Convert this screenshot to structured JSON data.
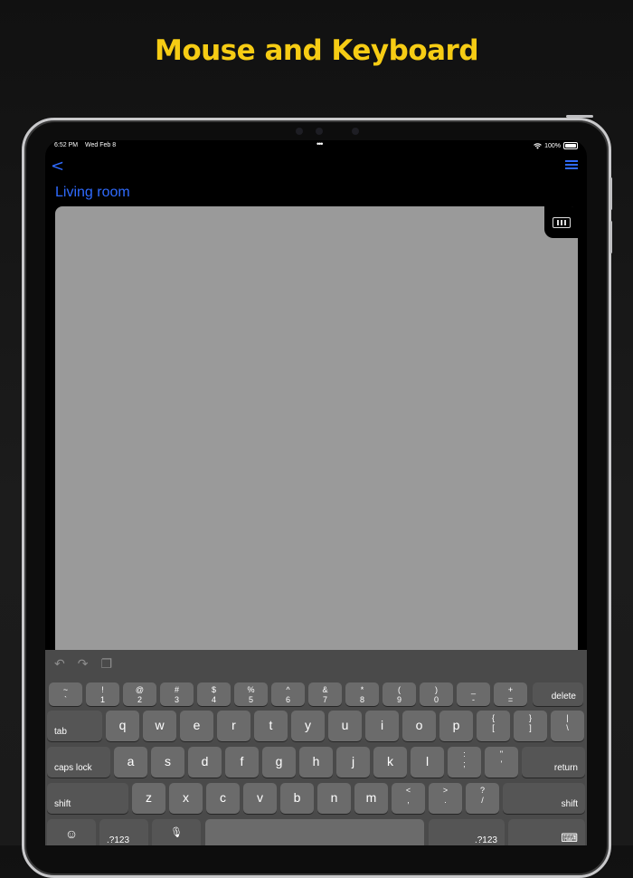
{
  "headline": "Mouse and Keyboard",
  "status_bar": {
    "time": "6:52 PM",
    "date": "Wed Feb 8",
    "battery": "100%"
  },
  "nav": {
    "back": "<"
  },
  "room_title": "Living room",
  "toolbar": {
    "undo": "↶",
    "redo": "↷",
    "paste": "❐"
  },
  "keyboard": {
    "row1": [
      {
        "top": "~",
        "bot": "`"
      },
      {
        "top": "!",
        "bot": "1"
      },
      {
        "top": "@",
        "bot": "2"
      },
      {
        "top": "#",
        "bot": "3"
      },
      {
        "top": "$",
        "bot": "4"
      },
      {
        "top": "%",
        "bot": "5"
      },
      {
        "top": "^",
        "bot": "6"
      },
      {
        "top": "&",
        "bot": "7"
      },
      {
        "top": "*",
        "bot": "8"
      },
      {
        "top": "(",
        "bot": "9"
      },
      {
        "top": ")",
        "bot": "0"
      },
      {
        "top": "_",
        "bot": "-"
      },
      {
        "top": "+",
        "bot": "="
      }
    ],
    "delete": "delete",
    "tab": "tab",
    "row2": [
      "q",
      "w",
      "e",
      "r",
      "t",
      "y",
      "u",
      "i",
      "o",
      "p"
    ],
    "row2_sym": [
      {
        "top": "{",
        "bot": "["
      },
      {
        "top": "}",
        "bot": "]"
      },
      {
        "top": "|",
        "bot": "\\"
      }
    ],
    "caps": "caps lock",
    "row3": [
      "a",
      "s",
      "d",
      "f",
      "g",
      "h",
      "j",
      "k",
      "l"
    ],
    "row3_sym": [
      {
        "top": ":",
        "bot": ";"
      },
      {
        "top": "\"",
        "bot": "'"
      }
    ],
    "return": "return",
    "shift_left": "shift",
    "row4": [
      "z",
      "x",
      "c",
      "v",
      "b",
      "n",
      "m"
    ],
    "row4_sym": [
      {
        "top": "<",
        "bot": ","
      },
      {
        "top": ">",
        "bot": "."
      },
      {
        "top": "?",
        "bot": "/"
      }
    ],
    "shift_right": "shift",
    "num_left": ".?123",
    "num_right": ".?123",
    "emoji": "☺",
    "mic": "🎙",
    "kb_dismiss": "⌨"
  }
}
